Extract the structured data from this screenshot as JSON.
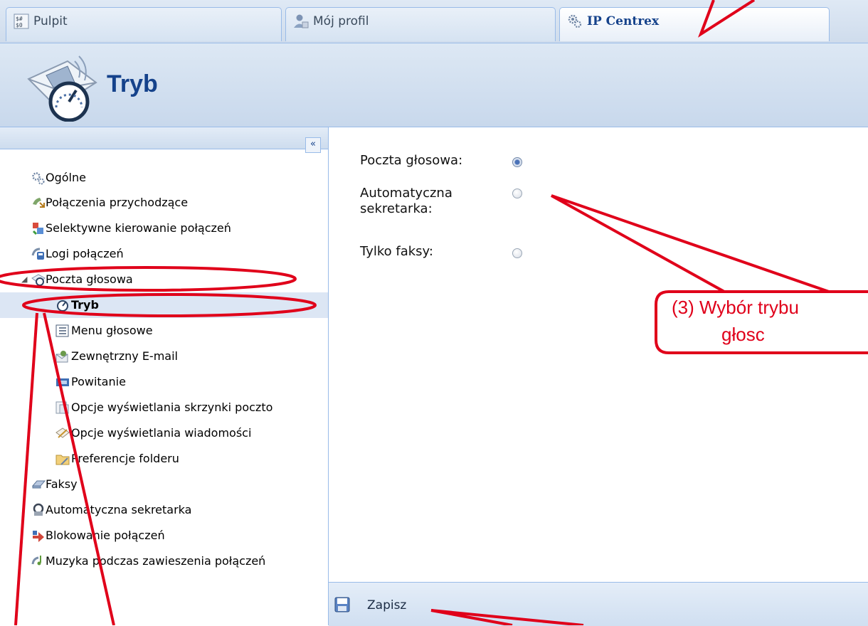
{
  "tabs": [
    {
      "label": "Pulpit",
      "icon": "dashboard-icon"
    },
    {
      "label": "Mój profil",
      "icon": "user-profile-icon"
    },
    {
      "label": "IP Centrex",
      "icon": "gears-icon",
      "active": true
    }
  ],
  "header": {
    "title": "Tryb",
    "icon": "voicemail-mode-icon"
  },
  "sidebar": {
    "collapse_label": "«",
    "items": [
      {
        "label": "Ogólne",
        "icon": "gears-icon"
      },
      {
        "label": "Połączenia przychodzące",
        "icon": "incoming-calls-icon"
      },
      {
        "label": "Selektywne kierowanie połączeń",
        "icon": "selective-routing-icon"
      },
      {
        "label": "Logi połączeń",
        "icon": "call-logs-icon"
      },
      {
        "label": "Poczta głosowa",
        "icon": "voicemail-icon",
        "expanded": true
      },
      {
        "label": "Tryb",
        "icon": "gauge-icon",
        "selected": true
      },
      {
        "label": "Menu głosowe",
        "icon": "voice-menu-icon"
      },
      {
        "label": "Zewnętrzny E-mail",
        "icon": "external-email-icon"
      },
      {
        "label": "Powitanie",
        "icon": "greeting-icon"
      },
      {
        "label": "Opcje wyświetlania skrzynki poczto",
        "icon": "mailbox-display-icon"
      },
      {
        "label": "Opcje wyświetlania wiadomości",
        "icon": "message-display-icon"
      },
      {
        "label": "Preferencje folderu",
        "icon": "folder-preferences-icon"
      },
      {
        "label": "Faksy",
        "icon": "fax-icon"
      },
      {
        "label": "Automatyczna sekretarka",
        "icon": "answering-machine-icon"
      },
      {
        "label": "Blokowanie połączeń",
        "icon": "call-blocking-icon"
      },
      {
        "label": "Muzyka podczas zawieszenia połączeń",
        "icon": "music-on-hold-icon"
      }
    ]
  },
  "form": {
    "voicemail_label": "Poczta głosowa:",
    "answering_machine_label_1": "Automatyczna",
    "answering_machine_label_2": "sekretarka:",
    "fax_only_label": "Tylko faksy:",
    "selected": "voicemail"
  },
  "footer": {
    "save_label": "Zapisz"
  },
  "annotation": {
    "callout_line_1": "(3) Wybór trybu",
    "callout_line_2": "głosc"
  },
  "colors": {
    "annotation": "#e0001a",
    "accent": "#15428b",
    "border": "#99bbe8"
  }
}
